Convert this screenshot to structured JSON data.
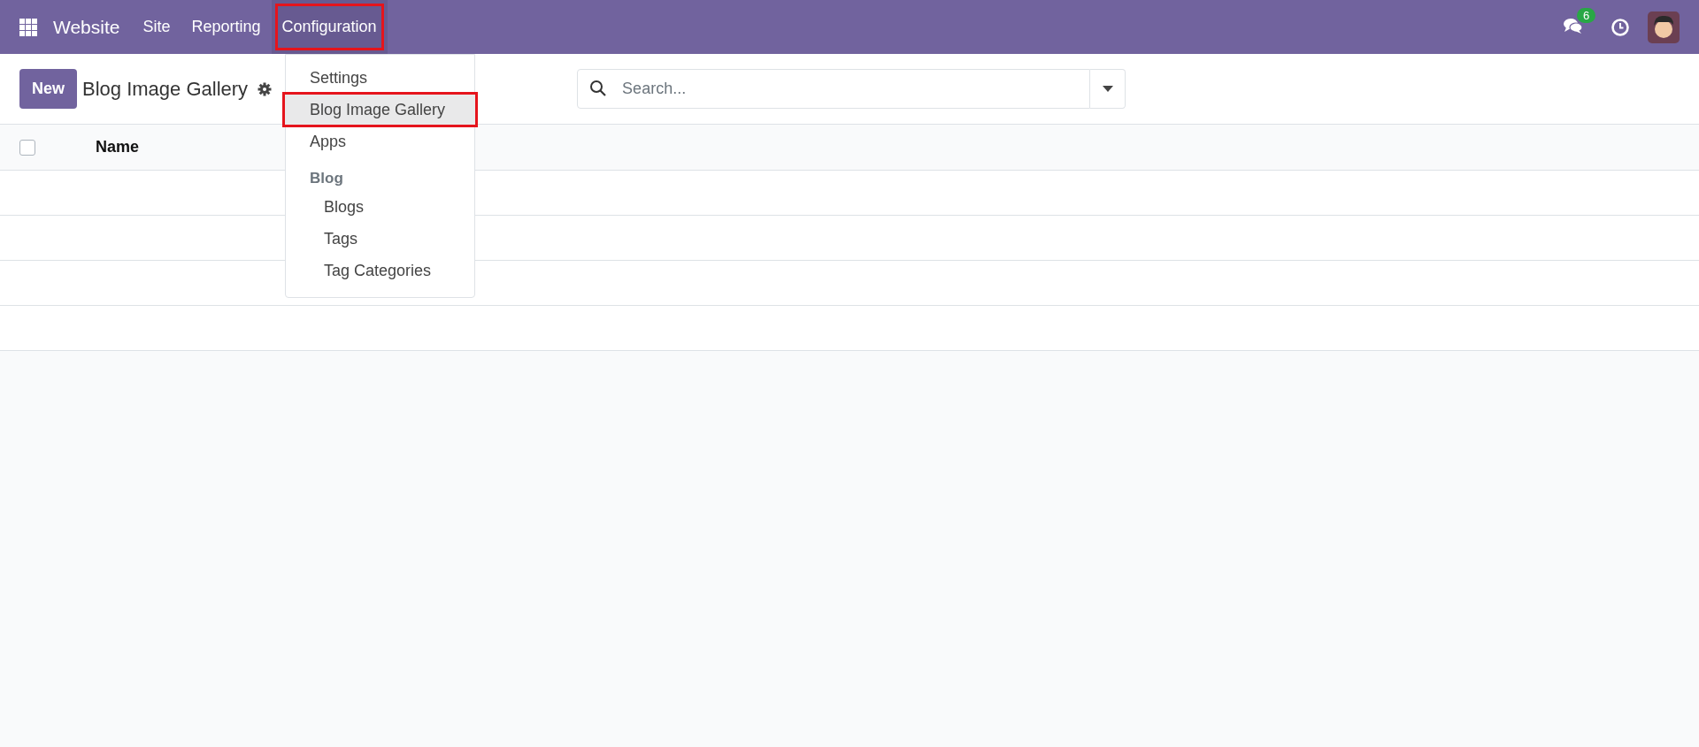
{
  "navbar": {
    "app_name": "Website",
    "menus": [
      {
        "label": "Site",
        "open": false,
        "highlighted": false
      },
      {
        "label": "Reporting",
        "open": false,
        "highlighted": false
      },
      {
        "label": "Configuration",
        "open": true,
        "highlighted": true
      }
    ],
    "message_count": "6"
  },
  "control_panel": {
    "new_button": "New",
    "title": "Blog Image Gallery",
    "search": {
      "placeholder": "Search..."
    }
  },
  "dropdown": {
    "items": [
      {
        "kind": "item",
        "label": "Settings",
        "selected": false,
        "highlighted": false
      },
      {
        "kind": "item",
        "label": "Blog Image Gallery",
        "selected": true,
        "highlighted": true
      },
      {
        "kind": "item",
        "label": "Apps",
        "selected": false,
        "highlighted": false
      },
      {
        "kind": "header",
        "label": "Blog"
      },
      {
        "kind": "subitem",
        "label": "Blogs",
        "selected": false,
        "highlighted": false
      },
      {
        "kind": "subitem",
        "label": "Tags",
        "selected": false,
        "highlighted": false
      },
      {
        "kind": "subitem",
        "label": "Tag Categories",
        "selected": false,
        "highlighted": false
      }
    ]
  },
  "list": {
    "select_all_checked": false,
    "columns": [
      "Name"
    ]
  }
}
